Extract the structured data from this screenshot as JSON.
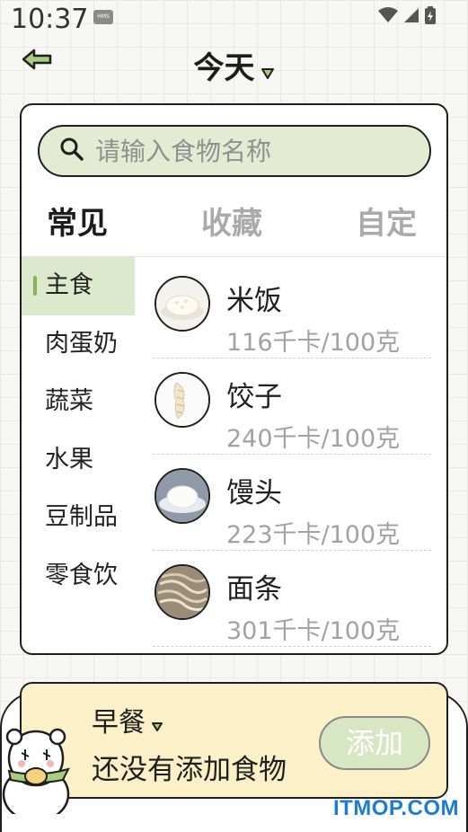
{
  "status_bar": {
    "time": "10:37",
    "badge": "HMS",
    "icons": [
      "wifi-icon",
      "signal-icon",
      "battery-charging-icon"
    ]
  },
  "header": {
    "title": "今天",
    "back_icon": "arrow-left-icon",
    "dropdown_icon": "triangle-down-icon"
  },
  "search": {
    "placeholder": "请输入食物名称",
    "icon": "search-icon"
  },
  "tabs": [
    {
      "label": "常见",
      "active": true
    },
    {
      "label": "收藏",
      "active": false
    },
    {
      "label": "自定",
      "active": false
    }
  ],
  "categories": [
    {
      "label": "主食",
      "active": true
    },
    {
      "label": "肉蛋奶",
      "active": false
    },
    {
      "label": "蔬菜",
      "active": false
    },
    {
      "label": "水果",
      "active": false
    },
    {
      "label": "豆制品",
      "active": false
    },
    {
      "label": "零食饮",
      "active": false
    }
  ],
  "foods": [
    {
      "name": "米饭",
      "kcal": "116千卡/100克",
      "image": "rice-image"
    },
    {
      "name": "饺子",
      "kcal": "240千卡/100克",
      "image": "dumplings-image"
    },
    {
      "name": "馒头",
      "kcal": "223千卡/100克",
      "image": "steamed-bun-image"
    },
    {
      "name": "面条",
      "kcal": "301千卡/100克",
      "image": "noodles-image"
    }
  ],
  "meal": {
    "name": "早餐",
    "empty_text": "还没有添加食物",
    "add_label": "添加",
    "mascot": "polar-bear-mascot"
  },
  "watermark": "ITMOP.COM",
  "colors": {
    "accent_green": "#dde9cc",
    "search_bg": "#e3ecd3",
    "tab_highlight": "#fbe6b5",
    "meal_card_bg": "#fbf0c8",
    "watermark": "#1b7bd8"
  }
}
